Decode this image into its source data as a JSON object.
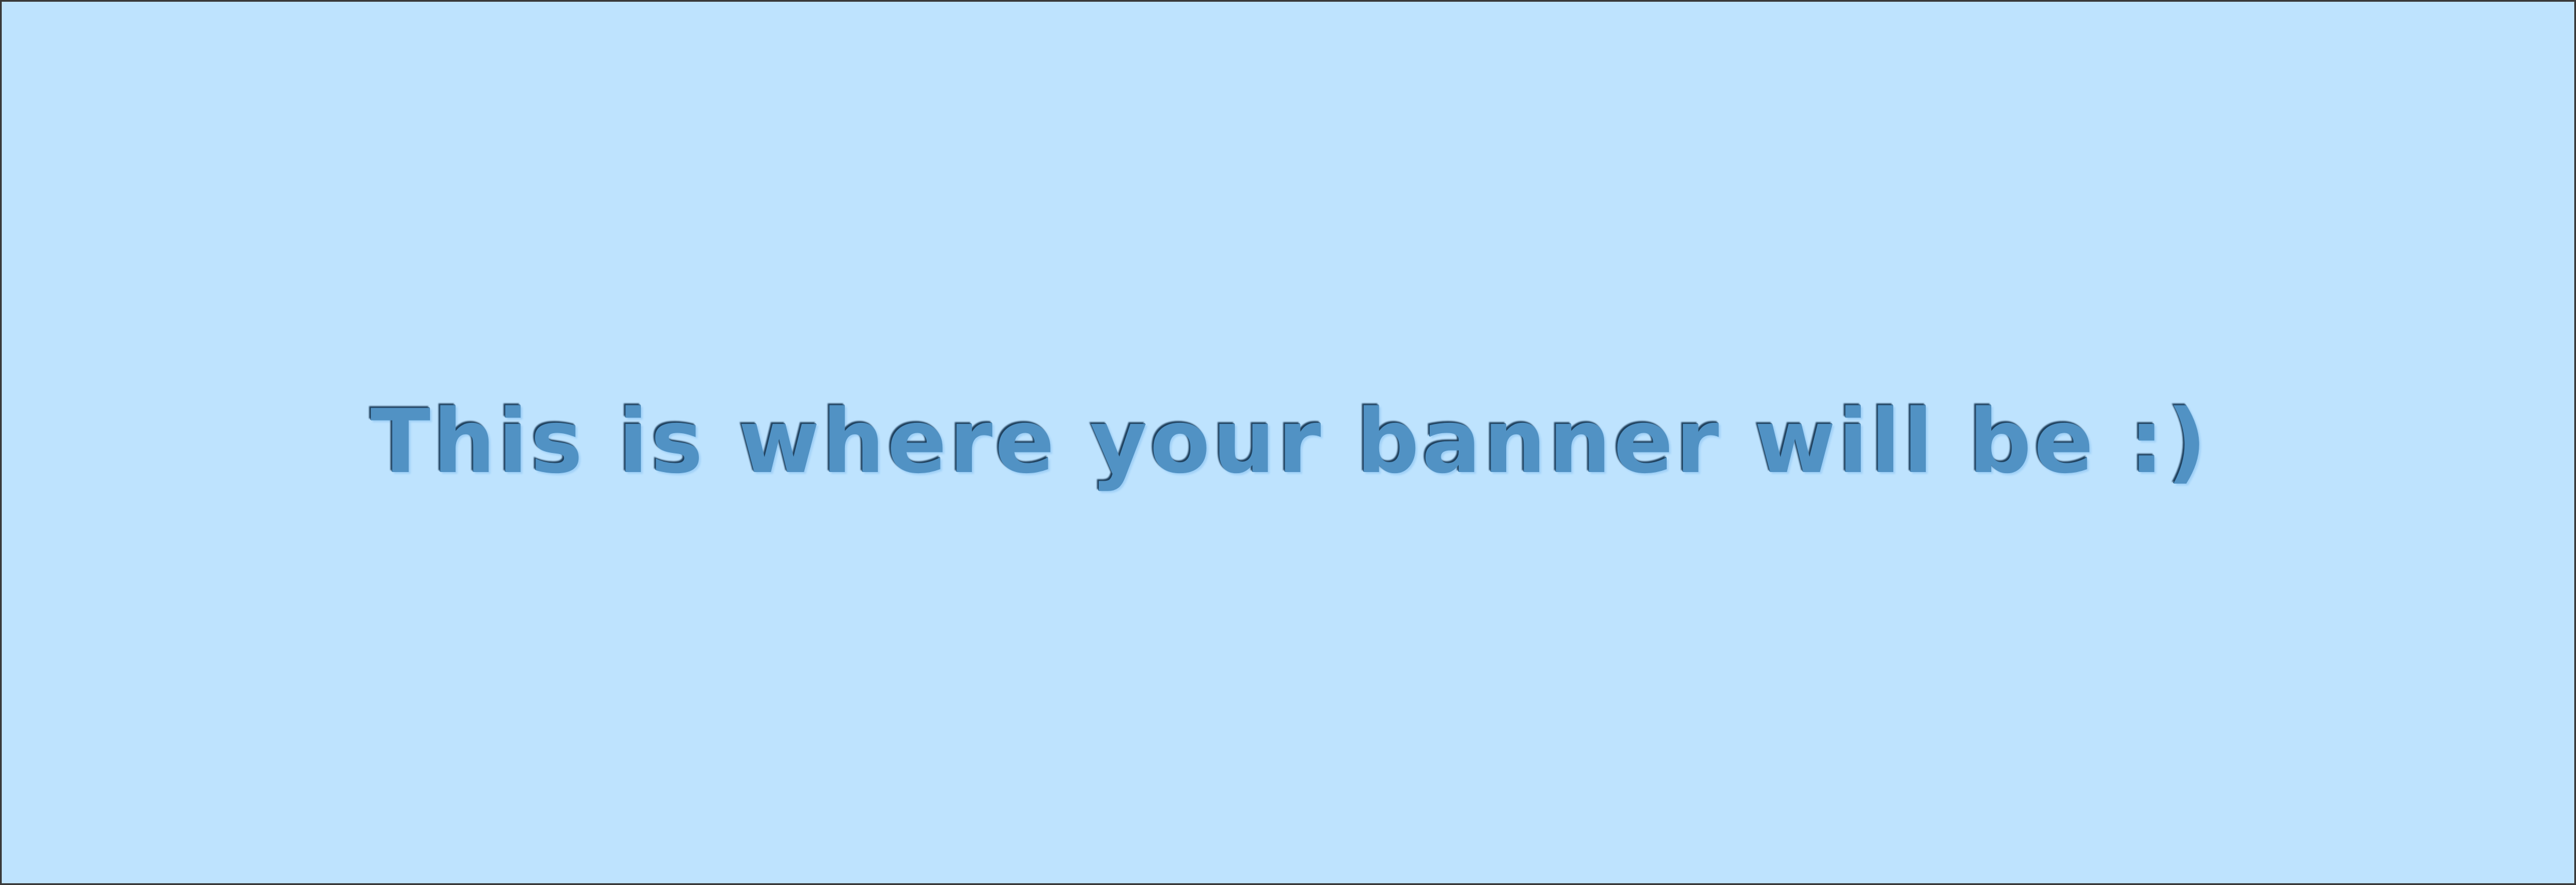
{
  "banner": {
    "text": "This is where your banner will be :)",
    "background_color": "#bee3fe",
    "text_color": "#5192c4"
  }
}
